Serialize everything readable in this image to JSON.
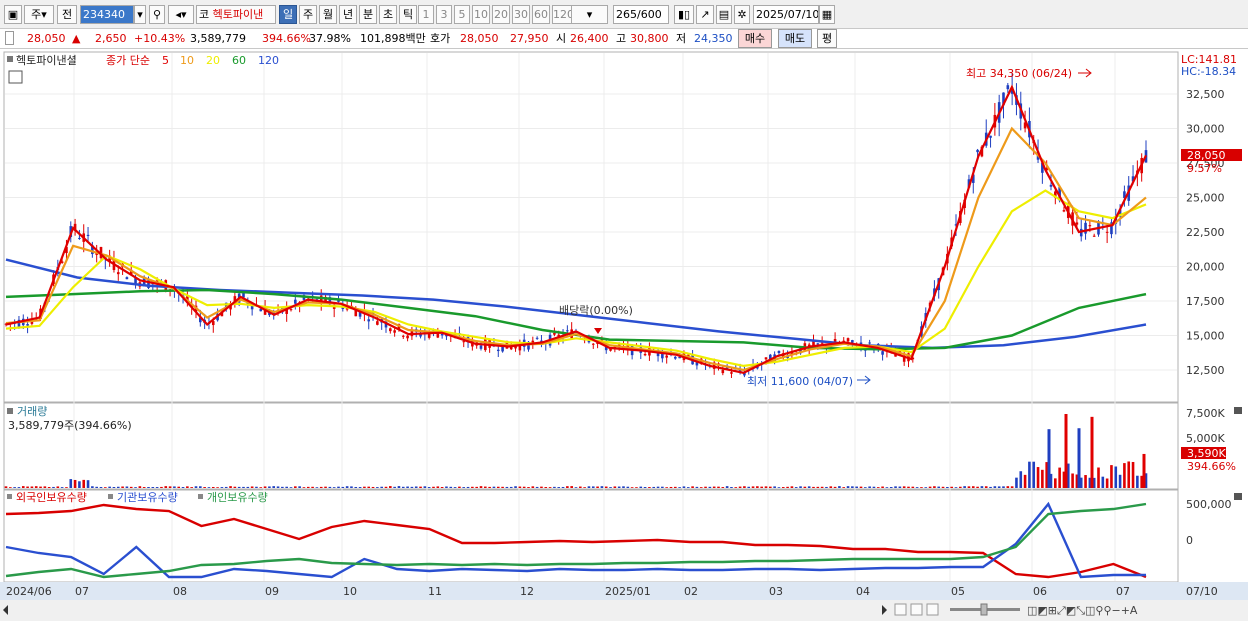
{
  "toolbar": {
    "layout_toggle": "주",
    "prev_label": "전",
    "code_value": "234340",
    "stock_prefix": "코",
    "stock_name": "헥토파이낸",
    "periods": [
      "일",
      "주",
      "월",
      "년",
      "분",
      "초",
      "틱"
    ],
    "active_period": "일",
    "intervals": [
      "1",
      "3",
      "5",
      "10",
      "20",
      "30",
      "60",
      "120"
    ],
    "count_value": "265",
    "count_max": "/600",
    "date_value": "2025/07/10"
  },
  "quote": {
    "price": "28,050",
    "arrow": "▲",
    "change": "2,650",
    "change_pct": "+10.43%",
    "volume": "3,589,779",
    "vol_ratio": "394.66%",
    "turnover": "37.98%",
    "amount": "101,898백만",
    "bid_label": "호가",
    "bid1": "28,050",
    "bid2": "27,950",
    "open_label": "시",
    "open": "26,400",
    "high_label": "고",
    "high": "30,800",
    "low_label": "저",
    "low": "24,350",
    "buy_button": "매수",
    "sell_button": "매도",
    "eval_button": "평"
  },
  "price_panel": {
    "stock_label": "헥토파이낸셜",
    "ma_prefix": "종가 단순",
    "ma_periods": [
      "5",
      "10",
      "20",
      "60",
      "120"
    ],
    "ma_colors": [
      "#e00000",
      "#ee9a1a",
      "#eeee00",
      "#199a2c",
      "#2a4fd0"
    ],
    "lc_label": "LC:141.81",
    "hc_label": "HC:-18.34",
    "high_annotation": "최고 34,350 (06/24)",
    "low_annotation": "최저 11,600 (04/07)",
    "dividend_annotation": "배당락(0.00%)",
    "current_price_tag": "28,050",
    "current_pct_tag": "9.57%",
    "y_ticks": [
      "32,500",
      "30,000",
      "27,500",
      "25,000",
      "22,500",
      "20,000",
      "17,500",
      "15,000",
      "12,500"
    ]
  },
  "volume_panel": {
    "title": "거래량",
    "value": "3,589,779주(394.66%)",
    "y_ticks": [
      "7,500K",
      "5,000K"
    ],
    "current_tag": "3,590K",
    "current_pct": "394.66%"
  },
  "holdings_panel": {
    "series": [
      "외국인보유수량",
      "기관보유수량",
      "개인보유수량"
    ],
    "colors": [
      "#d80000",
      "#2a4fd0",
      "#2a9a4a"
    ],
    "y_ticks": [
      "500,000",
      "0"
    ]
  },
  "x_axis": {
    "labels": [
      "2024/06",
      "07",
      "08",
      "09",
      "10",
      "11",
      "12",
      "2025/01",
      "02",
      "03",
      "04",
      "05",
      "06",
      "07",
      "07/10"
    ]
  },
  "chart_data": {
    "type": "line",
    "title": "헥토파이낸셜",
    "price_ma": [
      {
        "name": "5",
        "values": [
          15800,
          16300,
          22800,
          20500,
          19000,
          18500,
          15800,
          17800,
          16500,
          17600,
          17300,
          16300,
          15100,
          15200,
          14400,
          14200,
          14500,
          15300,
          14100,
          13900,
          13600,
          12800,
          12300,
          13500,
          14200,
          14500,
          14100,
          13300,
          20000,
          28000,
          33000,
          27000,
          22500,
          23000,
          28050
        ]
      },
      {
        "name": "10",
        "values": [
          15900,
          16100,
          21500,
          20800,
          19300,
          18400,
          16300,
          17600,
          16700,
          17400,
          17300,
          16500,
          15400,
          15200,
          14600,
          14300,
          14400,
          15100,
          14300,
          14000,
          13700,
          13000,
          12500,
          13300,
          14000,
          14400,
          14200,
          13500,
          17500,
          25000,
          30000,
          27500,
          23500,
          23000,
          25000
        ]
      },
      {
        "name": "20",
        "values": [
          15500,
          15700,
          18500,
          20800,
          19800,
          18400,
          17200,
          17300,
          17000,
          17200,
          17100,
          16700,
          15800,
          15300,
          14900,
          14500,
          14400,
          14800,
          14500,
          14200,
          13900,
          13300,
          12800,
          13100,
          13600,
          14100,
          14200,
          13800,
          15500,
          20000,
          24000,
          25500,
          24000,
          23500,
          24500
        ]
      }
    ],
    "price_high": 34350,
    "price_low": 11600,
    "ylim": [
      11000,
      35000
    ],
    "volume_peaks_k": [
      6200,
      7800,
      7500,
      6300,
      3590
    ]
  }
}
